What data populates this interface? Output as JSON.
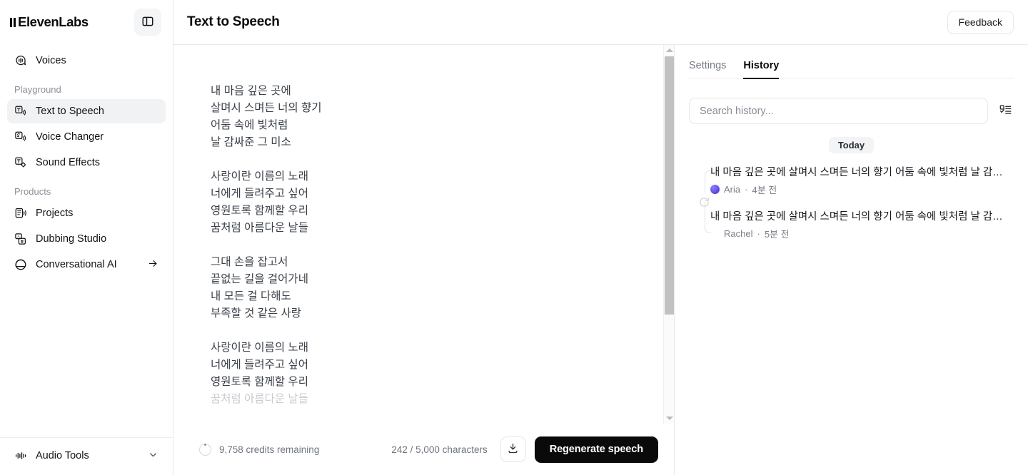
{
  "sidebar": {
    "brand": "ElevenLabs",
    "panel_toggle_icon": "panel-left-icon",
    "top_items": [
      {
        "label": "Voices",
        "icon": "voices-icon"
      }
    ],
    "sections": [
      {
        "title": "Playground",
        "items": [
          {
            "label": "Text to Speech",
            "icon": "text-to-speech-icon",
            "active": true
          },
          {
            "label": "Voice Changer",
            "icon": "voice-changer-icon",
            "active": false
          },
          {
            "label": "Sound Effects",
            "icon": "sound-effects-icon",
            "active": false
          }
        ]
      },
      {
        "title": "Products",
        "items": [
          {
            "label": "Projects",
            "icon": "projects-icon",
            "active": false
          },
          {
            "label": "Dubbing Studio",
            "icon": "dubbing-studio-icon",
            "active": false
          },
          {
            "label": "Conversational AI",
            "icon": "conversational-ai-icon",
            "active": false,
            "trailing_icon": "arrow-right-icon"
          }
        ]
      }
    ],
    "bottom": {
      "label": "Audio Tools",
      "icon": "audio-tools-icon",
      "trailing_icon": "chevron-down-icon"
    }
  },
  "header": {
    "title": "Text to Speech",
    "feedback_label": "Feedback"
  },
  "editor": {
    "text": "내 마음 깊은 곳에\n살며시 스며든 너의 향기\n어둠 속에 빛처럼\n날 감싸준 그 미소\n\n사랑이란 이름의 노래\n너에게 들려주고 싶어\n영원토록 함께할 우리\n꿈처럼 아름다운 날들\n\n그대 손을 잡고서\n끝없는 길을 걸어가네\n내 모든 걸 다해도\n부족할 것 같은 사랑\n\n사랑이란 이름의 노래\n너에게 들려주고 싶어\n영원토록 함께할 우리",
    "text_faded_tail": "꿈처럼 아름다운 날들",
    "credits_label": "9,758 credits remaining",
    "credits_icon": "credit-ring-icon",
    "character_count": "242 / 5,000 characters",
    "download_icon": "download-icon",
    "regenerate_label": "Regenerate speech",
    "scrollbar": {
      "up_arrow_icon": "scroll-up-arrow-icon",
      "down_arrow_icon": "scroll-down-arrow-icon"
    }
  },
  "side_panel": {
    "tabs": [
      {
        "label": "Settings",
        "active": false
      },
      {
        "label": "History",
        "active": true
      }
    ],
    "search": {
      "value": "",
      "placeholder": "Search history...",
      "filter_icon": "filter-list-icon"
    },
    "group_label": "Today",
    "regenerate_connector_icon": "refresh-icon",
    "history": [
      {
        "text": "내 마음 깊은 곳에 살며시 스며든 너의 향기 어둠 속에 빛처럼 날 감…",
        "voice": "Aria",
        "time": "4분 전",
        "avatar": "aria"
      },
      {
        "text": "내 마음 깊은 곳에 살며시 스며든 너의 향기 어둠 속에 빛처럼 날 감…",
        "voice": "Rachel",
        "time": "5분 전",
        "avatar": "rachel"
      }
    ]
  }
}
